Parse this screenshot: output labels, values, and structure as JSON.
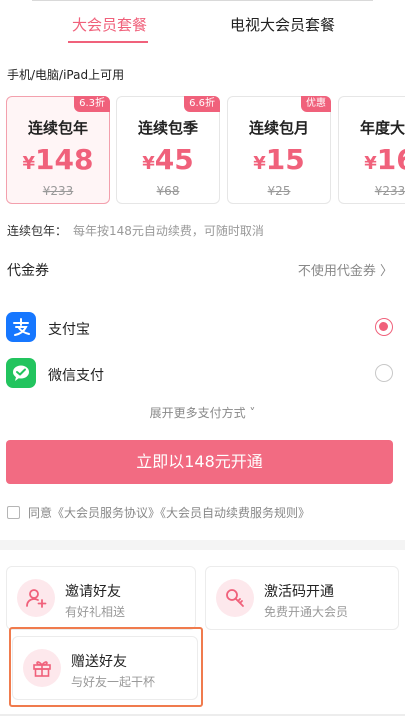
{
  "tabs": [
    {
      "label": "大会员套餐",
      "active": true
    },
    {
      "label": "电视大会员套餐",
      "active": false
    }
  ],
  "devices_note": "手机/电脑/iPad上可用",
  "plans": [
    {
      "badge": "6.3折",
      "name": "连续包年",
      "currency": "¥",
      "price": "148",
      "original": "¥233",
      "selected": true
    },
    {
      "badge": "6.6折",
      "name": "连续包季",
      "currency": "¥",
      "price": "45",
      "original": "¥68",
      "selected": false
    },
    {
      "badge": "优惠",
      "name": "连续包月",
      "currency": "¥",
      "price": "15",
      "original": "¥25",
      "selected": false
    },
    {
      "badge": "",
      "name": "年度大会",
      "currency": "¥",
      "price": "16",
      "original": "¥233",
      "selected": false
    }
  ],
  "renew": {
    "label": "连续包年：",
    "desc": "每年按148元自动续费，可随时取消"
  },
  "voucher": {
    "label": "代金券",
    "value": "不使用代金券 〉"
  },
  "payments": [
    {
      "name": "支付宝",
      "icon": "alipay-icon",
      "color": "#1677ff",
      "selected": true
    },
    {
      "name": "微信支付",
      "icon": "wechat-pay-icon",
      "color": "#22c45e",
      "selected": false
    }
  ],
  "more_payments": "展开更多支付方式 ˅",
  "cta_label": "立即以148元开通",
  "agreement": "同意《大会员服务协议》《大会员自动续费服务规则》",
  "features": [
    {
      "title": "邀请好友",
      "subtitle": "有好礼相送",
      "icon": "invite-friend-icon"
    },
    {
      "title": "激活码开通",
      "subtitle": "免费开通大会员",
      "icon": "key-icon"
    },
    {
      "title": "赠送好友",
      "subtitle": "与好友一起干杯",
      "icon": "gift-icon"
    }
  ],
  "colors": {
    "accent": "#f0617b",
    "highlight": "#f07b4d"
  }
}
